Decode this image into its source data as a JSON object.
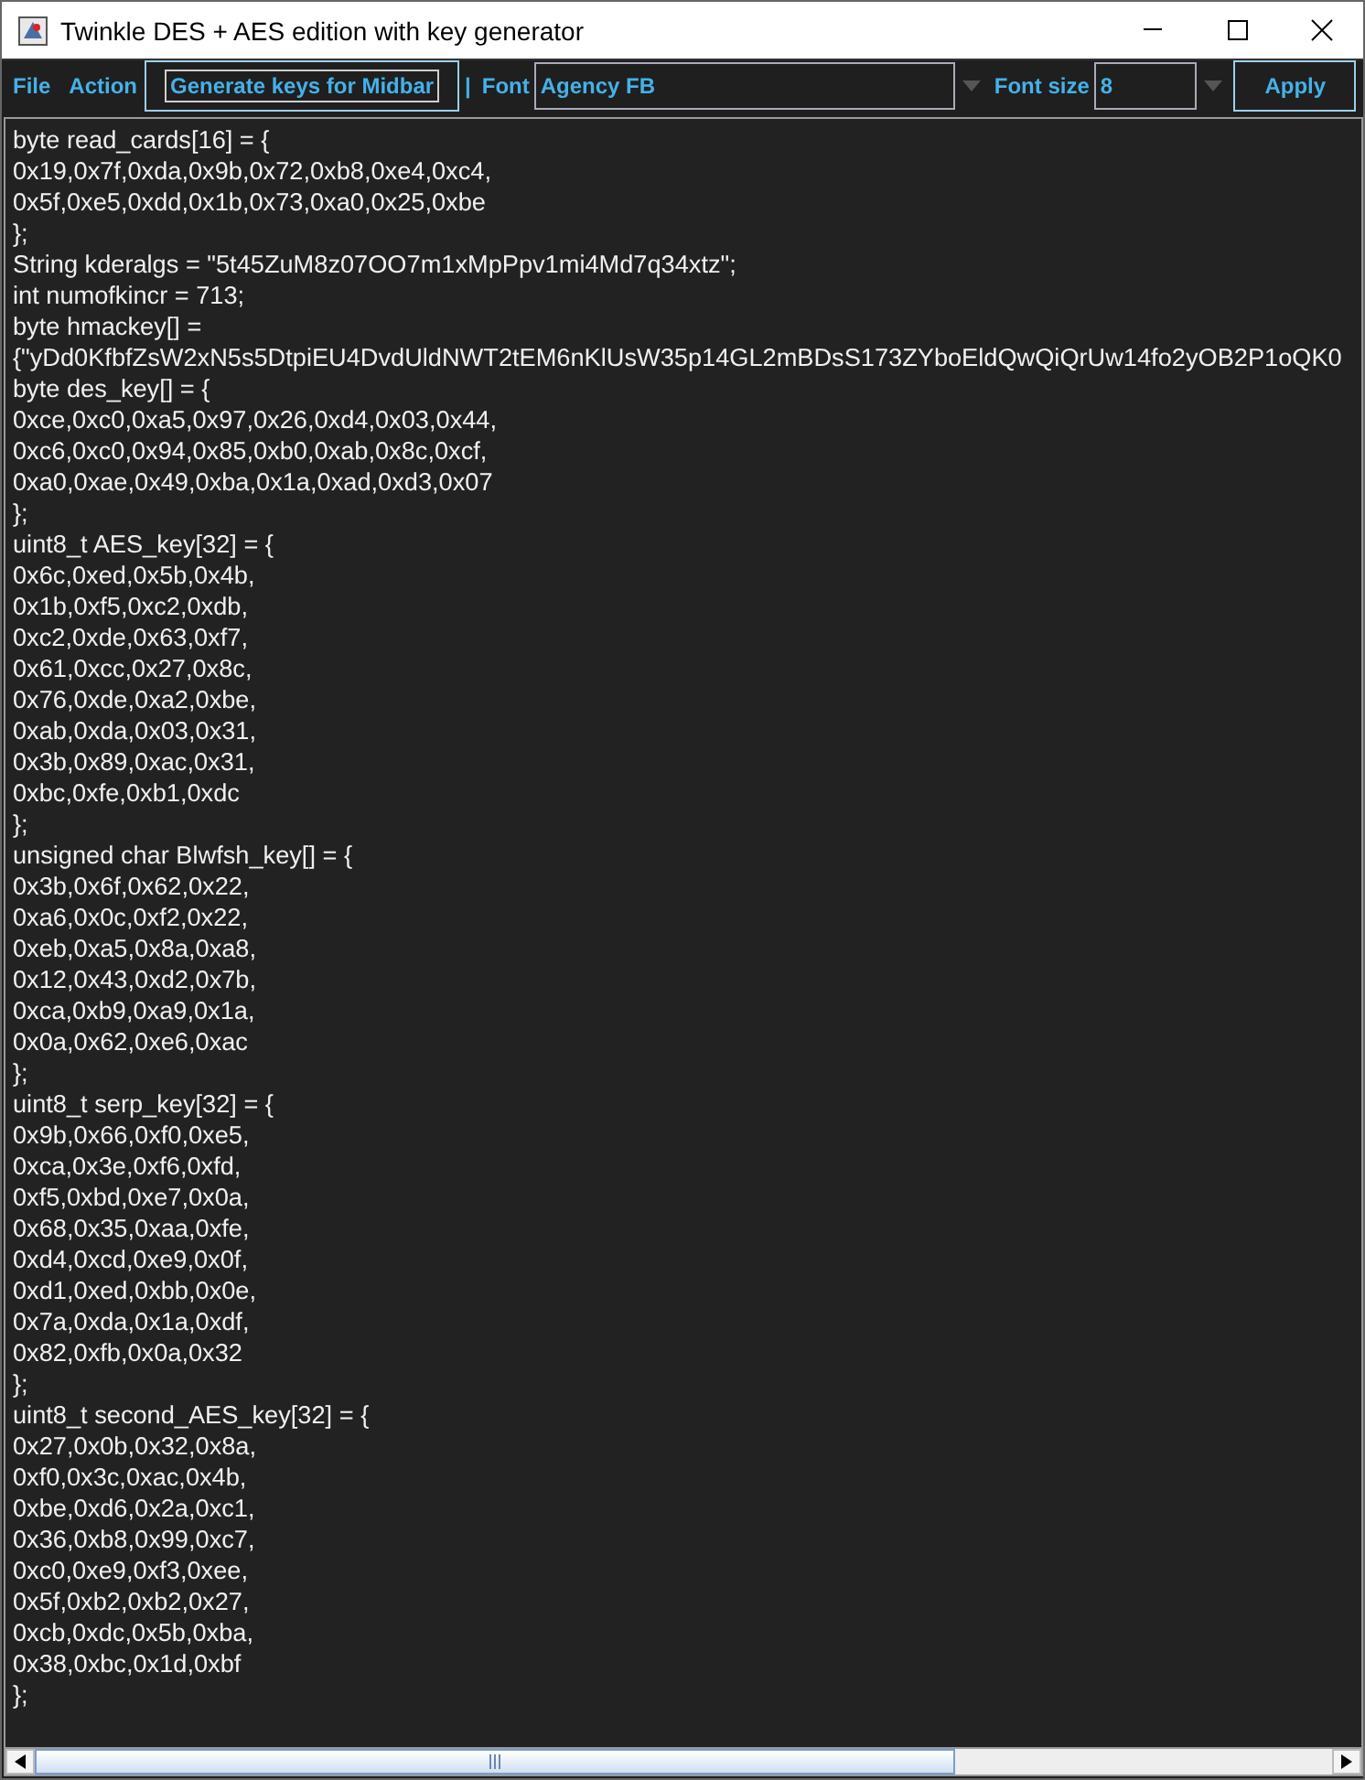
{
  "window": {
    "title": "Twinkle DES + AES edition with key generator"
  },
  "menu": [
    "File",
    "Action"
  ],
  "toolbar": {
    "generate_button": "Generate keys for Midbar",
    "separator": "|",
    "font_label": "Font",
    "font_value": "Agency FB",
    "font_size_label": "Font size",
    "font_size_value": "8",
    "apply_button": "Apply"
  },
  "editor": {
    "lines": [
      "byte read_cards[16] = {",
      "0x19,0x7f,0xda,0x9b,0x72,0xb8,0xe4,0xc4,",
      "0x5f,0xe5,0xdd,0x1b,0x73,0xa0,0x25,0xbe",
      "};",
      "String kderalgs = \"5t45ZuM8z07OO7m1xMpPpv1mi4Md7q34xtz\";",
      "int numofkincr = 713;",
      "byte hmackey[] =",
      "{\"yDd0KfbfZsW2xN5s5DtpiEU4DvdUldNWT2tEM6nKlUsW35p14GL2mBDsS173ZYboEldQwQiQrUw14fo2yOB2P1oQK0",
      "byte des_key[] = {",
      "0xce,0xc0,0xa5,0x97,0x26,0xd4,0x03,0x44,",
      "0xc6,0xc0,0x94,0x85,0xb0,0xab,0x8c,0xcf,",
      "0xa0,0xae,0x49,0xba,0x1a,0xad,0xd3,0x07",
      "};",
      "uint8_t AES_key[32] = {",
      "0x6c,0xed,0x5b,0x4b,",
      "0x1b,0xf5,0xc2,0xdb,",
      "0xc2,0xde,0x63,0xf7,",
      "0x61,0xcc,0x27,0x8c,",
      "0x76,0xde,0xa2,0xbe,",
      "0xab,0xda,0x03,0x31,",
      "0x3b,0x89,0xac,0x31,",
      "0xbc,0xfe,0xb1,0xdc",
      "};",
      "unsigned char Blwfsh_key[] = {",
      "0x3b,0x6f,0x62,0x22,",
      "0xa6,0x0c,0xf2,0x22,",
      "0xeb,0xa5,0x8a,0xa8,",
      "0x12,0x43,0xd2,0x7b,",
      "0xca,0xb9,0xa9,0x1a,",
      "0x0a,0x62,0xe6,0xac",
      "};",
      "uint8_t serp_key[32] = {",
      "0x9b,0x66,0xf0,0xe5,",
      "0xca,0x3e,0xf6,0xfd,",
      "0xf5,0xbd,0xe7,0x0a,",
      "0x68,0x35,0xaa,0xfe,",
      "0xd4,0xcd,0xe9,0x0f,",
      "0xd1,0xed,0xbb,0x0e,",
      "0x7a,0xda,0x1a,0xdf,",
      "0x82,0xfb,0x0a,0x32",
      "};",
      "uint8_t second_AES_key[32] = {",
      "0x27,0x0b,0x32,0x8a,",
      "0xf0,0x3c,0xac,0x4b,",
      "0xbe,0xd6,0x2a,0xc1,",
      "0x36,0xb8,0x99,0xc7,",
      "0xc0,0xe9,0xf3,0xee,",
      "0x5f,0xb2,0xb2,0x27,",
      "0xcb,0xdc,0x5b,0xba,",
      "0x38,0xbc,0x1d,0xbf",
      "};"
    ]
  }
}
